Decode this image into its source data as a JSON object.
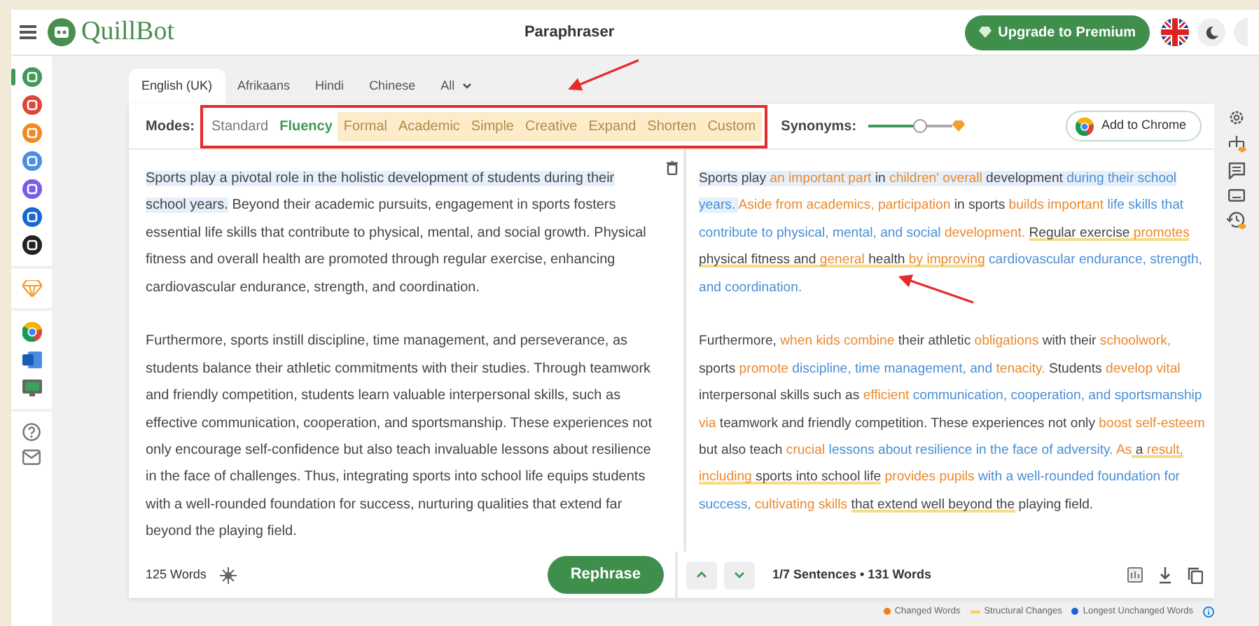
{
  "header": {
    "logo": "QuillBot",
    "title": "Paraphraser",
    "upgrade_button": "Upgrade to Premium"
  },
  "sidebar_tools": [
    {
      "color": "#3f9a57",
      "selected": true
    },
    {
      "color": "#e0453a",
      "selected": false
    },
    {
      "color": "#f08a24",
      "selected": false
    },
    {
      "color": "#4a90e2",
      "selected": false
    },
    {
      "color": "#7b5ce6",
      "selected": false
    },
    {
      "color": "#1967d2",
      "selected": false
    },
    {
      "color": "#222222",
      "selected": false
    }
  ],
  "language_tabs": [
    {
      "label": "English (UK)",
      "selected": true
    },
    {
      "label": "Afrikaans",
      "selected": false
    },
    {
      "label": "Hindi",
      "selected": false
    },
    {
      "label": "Chinese",
      "selected": false
    },
    {
      "label": "All",
      "selected": false,
      "kind": "dropdown"
    }
  ],
  "modes": {
    "label": "Modes:",
    "items": [
      {
        "label": "Standard",
        "selected": false,
        "premium": false
      },
      {
        "label": "Fluency",
        "selected": true,
        "premium": false
      },
      {
        "label": "Formal",
        "selected": false,
        "premium": true
      },
      {
        "label": "Academic",
        "selected": false,
        "premium": true
      },
      {
        "label": "Simple",
        "selected": false,
        "premium": true
      },
      {
        "label": "Creative",
        "selected": false,
        "premium": true
      },
      {
        "label": "Expand",
        "selected": false,
        "premium": true
      },
      {
        "label": "Shorten",
        "selected": false,
        "premium": true
      },
      {
        "label": "Custom",
        "selected": false,
        "premium": true
      }
    ]
  },
  "synonyms": {
    "label": "Synonyms:",
    "level": 0.63
  },
  "chrome_button": "Add to Chrome",
  "input": {
    "paragraphs": [
      [
        {
          "text": "Sports play a pivotal role in the holistic development of students during their school years.",
          "highlighted": true
        },
        {
          "text": " Beyond their academic pursuits, engagement in sports fosters essential life skills that contribute to physical, mental, and social growth. Physical fitness and overall health are promoted through regular exercise, enhancing cardiovascular endurance, strength, and coordination.",
          "highlighted": false
        }
      ],
      [
        {
          "text": "Furthermore, sports instill discipline, time management, and perseverance, as students balance their athletic commitments with their studies. Through teamwork and friendly competition, students learn valuable interpersonal skills, such as effective communication, cooperation, and sportsmanship. These experiences not only encourage self-confidence but also teach invaluable lessons about resilience in the face of challenges. Thus, integrating sports into school life equips students with a well-rounded foundation for success, nurturing qualities that extend far beyond the playing field.",
          "highlighted": false
        }
      ]
    ],
    "word_count": "125 Words",
    "rephrase_button": "Rephrase"
  },
  "output": {
    "paragraphs": [
      [
        {
          "text": "Sports play ",
          "kind": "plain",
          "structural": false,
          "highlighted": true
        },
        {
          "text": "an important part",
          "kind": "changed",
          "structural": false,
          "highlighted": true
        },
        {
          "text": " in ",
          "kind": "plain",
          "structural": false,
          "highlighted": true
        },
        {
          "text": "children' overall",
          "kind": "changed",
          "structural": false,
          "highlighted": true
        },
        {
          "text": " development ",
          "kind": "plain",
          "structural": false,
          "highlighted": true
        },
        {
          "text": "during their school years. ",
          "kind": "unchanged",
          "structural": false,
          "highlighted": true
        },
        {
          "text": "Aside from academics, participation",
          "kind": "changed",
          "structural": false,
          "highlighted": false
        },
        {
          "text": " in sports ",
          "kind": "plain",
          "structural": false,
          "highlighted": false
        },
        {
          "text": "builds important",
          "kind": "changed",
          "structural": false,
          "highlighted": false
        },
        {
          "text": " life skills that contribute to physical, mental, and social",
          "kind": "unchanged",
          "structural": false,
          "highlighted": false
        },
        {
          "text": " development. ",
          "kind": "changed",
          "structural": false,
          "highlighted": false
        },
        {
          "text": "Regular exercise ",
          "kind": "plain",
          "structural": true,
          "highlighted": false
        },
        {
          "text": "promotes",
          "kind": "changed",
          "structural": true,
          "highlighted": false
        },
        {
          "text": " physical fitness and ",
          "kind": "plain",
          "structural": true,
          "highlighted": false
        },
        {
          "text": "general",
          "kind": "changed",
          "structural": true,
          "highlighted": false
        },
        {
          "text": " health ",
          "kind": "plain",
          "structural": true,
          "highlighted": false
        },
        {
          "text": "by improving",
          "kind": "changed",
          "structural": true,
          "highlighted": false
        },
        {
          "text": " cardiovascular endurance, strength, and coordination.",
          "kind": "unchanged",
          "structural": false,
          "highlighted": false
        }
      ],
      [
        {
          "text": "Furthermore, ",
          "kind": "plain",
          "structural": false,
          "highlighted": false
        },
        {
          "text": "when kids combine",
          "kind": "changed",
          "structural": false,
          "highlighted": false
        },
        {
          "text": " their athletic ",
          "kind": "plain",
          "structural": false,
          "highlighted": false
        },
        {
          "text": "obligations",
          "kind": "changed",
          "structural": false,
          "highlighted": false
        },
        {
          "text": " with their ",
          "kind": "plain",
          "structural": false,
          "highlighted": false
        },
        {
          "text": "schoolwork,",
          "kind": "changed",
          "structural": false,
          "highlighted": false
        },
        {
          "text": " sports ",
          "kind": "plain",
          "structural": false,
          "highlighted": false
        },
        {
          "text": "promote",
          "kind": "changed",
          "structural": false,
          "highlighted": false
        },
        {
          "text": " discipline, time management, and",
          "kind": "unchanged",
          "structural": false,
          "highlighted": false
        },
        {
          "text": " tenacity.",
          "kind": "changed",
          "structural": false,
          "highlighted": false
        },
        {
          "text": " Students ",
          "kind": "plain",
          "structural": false,
          "highlighted": false
        },
        {
          "text": "develop vital",
          "kind": "changed",
          "structural": false,
          "highlighted": false
        },
        {
          "text": " interpersonal skills such as ",
          "kind": "plain",
          "structural": false,
          "highlighted": false
        },
        {
          "text": "efficient",
          "kind": "changed",
          "structural": false,
          "highlighted": false
        },
        {
          "text": " communication, cooperation, and sportsmanship",
          "kind": "unchanged",
          "structural": false,
          "highlighted": false
        },
        {
          "text": " via",
          "kind": "changed",
          "structural": false,
          "highlighted": false
        },
        {
          "text": " teamwork and friendly competition. These experiences not only ",
          "kind": "plain",
          "structural": false,
          "highlighted": false
        },
        {
          "text": "boost self-esteem",
          "kind": "changed",
          "structural": false,
          "highlighted": false
        },
        {
          "text": " but also teach ",
          "kind": "plain",
          "structural": false,
          "highlighted": false
        },
        {
          "text": "crucial",
          "kind": "changed",
          "structural": false,
          "highlighted": false
        },
        {
          "text": " lessons about resilience in the face of adversity.",
          "kind": "unchanged",
          "structural": false,
          "highlighted": false
        },
        {
          "text": " As",
          "kind": "changed",
          "structural": false,
          "highlighted": false
        },
        {
          "text": " a ",
          "kind": "plain",
          "structural": true,
          "highlighted": false
        },
        {
          "text": "result, including",
          "kind": "changed",
          "structural": true,
          "highlighted": false
        },
        {
          "text": " sports into school life",
          "kind": "plain",
          "structural": true,
          "highlighted": false
        },
        {
          "text": " provides pupils",
          "kind": "changed",
          "structural": false,
          "highlighted": false
        },
        {
          "text": " with a well-rounded foundation for success,",
          "kind": "unchanged",
          "structural": false,
          "highlighted": false
        },
        {
          "text": " cultivating skills ",
          "kind": "changed",
          "structural": false,
          "highlighted": false
        },
        {
          "text": "that extend well beyond the",
          "kind": "plain",
          "structural": true,
          "highlighted": false
        },
        {
          "text": " playing field.",
          "kind": "plain",
          "structural": false,
          "highlighted": false
        }
      ]
    ],
    "sentence_info": "1/7 Sentences • 131 Words"
  },
  "legend": [
    {
      "label": "Changed Words",
      "color": "#f07c1a",
      "kind": "dot"
    },
    {
      "label": "Structural Changes",
      "color": "#f5d35a",
      "kind": "line"
    },
    {
      "label": "Longest Unchanged Words",
      "color": "#1565d8",
      "kind": "dot"
    }
  ]
}
